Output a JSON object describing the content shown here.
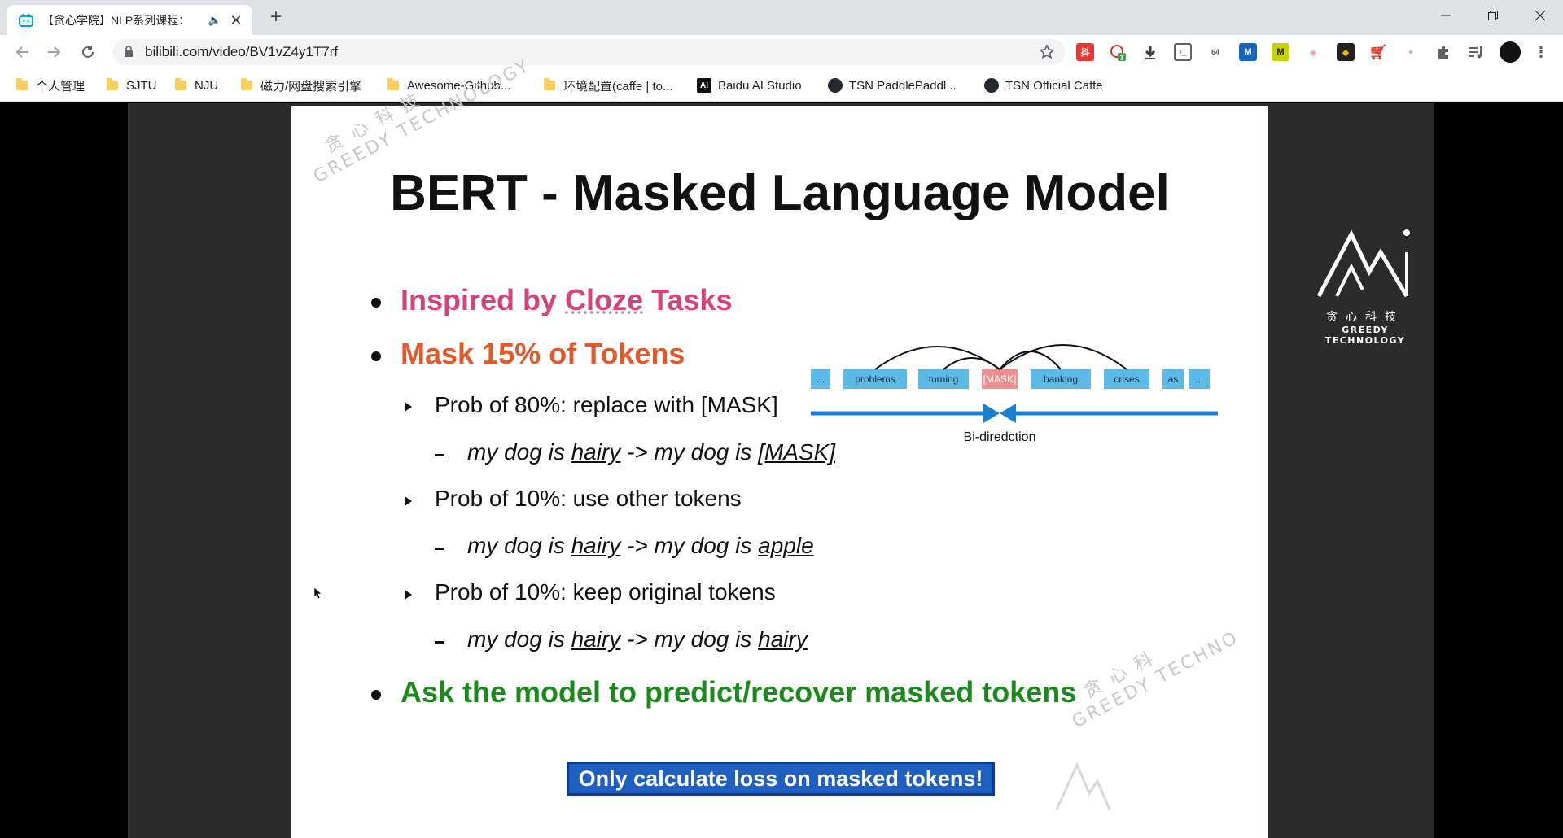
{
  "browser": {
    "tab_title": "【贪心学院】NLP系列课程：",
    "tab_audio_icon": "🔈",
    "tab_close": "✕",
    "new_tab": "+",
    "url": "bilibili.com/video/BV1vZ4y1T7rf",
    "bookmarks": [
      {
        "label": "个人管理",
        "icon": "folder-icon"
      },
      {
        "label": "SJTU",
        "icon": "folder-icon"
      },
      {
        "label": "NJU",
        "icon": "folder-icon"
      },
      {
        "label": "磁力/网盘搜索引擎",
        "icon": "folder-icon"
      },
      {
        "label": "Awesome-Github...",
        "icon": "folder-icon"
      },
      {
        "label": "环境配置(caffe | to...",
        "icon": "folder-icon"
      },
      {
        "label": "Baidu AI Studio",
        "icon": "ai-studio-icon"
      },
      {
        "label": "TSN PaddlePaddl...",
        "icon": "github-icon"
      },
      {
        "label": "TSN Official Caffe",
        "icon": "github-icon"
      }
    ],
    "ext_badge": "1"
  },
  "slide": {
    "title": "BERT - Masked Language Model",
    "watermark_top": "贪 心 科 技",
    "watermark_top_en": "GREEDY TECHNOLOGY",
    "watermark_bottom": "贪 心 科",
    "watermark_bottom_en": "GREEDY TECHNO",
    "bullet1_pre": "Inspired by ",
    "bullet1_key": "Cloze",
    "bullet1_post": " Tasks",
    "bullet2": "Mask 15% of Tokens",
    "sub1": "Prob of 80%: replace with [MASK]",
    "ex1_a": "my dog is ",
    "ex1_b": "hairy",
    "ex1_c": " -> my dog is ",
    "ex1_d": "[MASK]",
    "sub2": "Prob of 10%:  use other tokens",
    "ex2_a": "my dog is ",
    "ex2_b": "hairy",
    "ex2_c": " -> my dog is ",
    "ex2_d": "apple",
    "sub3": "Prob of 10%: keep original tokens",
    "ex3_a": "my dog is ",
    "ex3_b": "hairy",
    "ex3_c": " -> my dog is ",
    "ex3_d": "hairy",
    "bullet3": "Ask the model to predict/recover masked tokens",
    "note": "Only calculate loss on masked tokens!",
    "diagram": {
      "tokens": [
        "...",
        "problems",
        "turning",
        "[MASK]",
        "banking",
        "crises",
        "as",
        "..."
      ],
      "caption": "Bi-diredction"
    },
    "colors": {
      "bullet1": "#d6427a",
      "bullet2": "#e05a2a",
      "bullet3": "#1a8a1a",
      "token": "#5bbbe6",
      "mask_token": "#f08f8f",
      "arrow": "#1a7fd0"
    }
  },
  "logo": {
    "cn": "贪心科技",
    "en": "GREEDY TECHNOLOGY"
  }
}
